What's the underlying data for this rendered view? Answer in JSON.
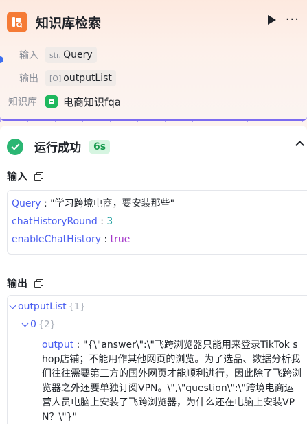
{
  "node": {
    "title": "知识库检索",
    "input_label": "输入",
    "input_type_prefix": "str.",
    "input_value": "Query",
    "output_label": "输出",
    "output_type_prefix": "[O]",
    "output_value": "outputList",
    "kb_label": "知识库",
    "kb_name": "电商知识fqa",
    "colors": {
      "accent": "#f57b36",
      "border": "#7b6bf0",
      "kb": "#1fb85e"
    }
  },
  "result": {
    "status_text": "运行成功",
    "duration": "6s",
    "input_title": "输入",
    "inputs": [
      {
        "key": "Query",
        "value": "\"学习跨境电商，要安装那些\"",
        "kind": "str"
      },
      {
        "key": "chatHistoryRound",
        "value": "3",
        "kind": "num"
      },
      {
        "key": "enableChatHistory",
        "value": "true",
        "kind": "bool"
      }
    ],
    "output_title": "输出",
    "output_root_key": "outputList",
    "output_root_count": "{1}",
    "output_item_key": "0",
    "output_item_count": "{2}",
    "output_field_key": "output",
    "output_field_value": "\"{\\\"answer\\\":\\\"飞跨浏览器只能用来登录TikTok shop店铺；不能用作其他网页的浏览。为了选品、数据分析我们往往需要第三方的国外网页才能顺利进行，因此除了飞跨浏览器之外还要单独订阅VPN。\\\",\\\"question\\\":\\\"跨境电商运营人员电脑上安装了飞跨浏览器，为什么还在电脑上安装VPN？\\\"}\"",
    "colors": {
      "success": "#2bb673",
      "key": "#4a5ef0"
    }
  }
}
